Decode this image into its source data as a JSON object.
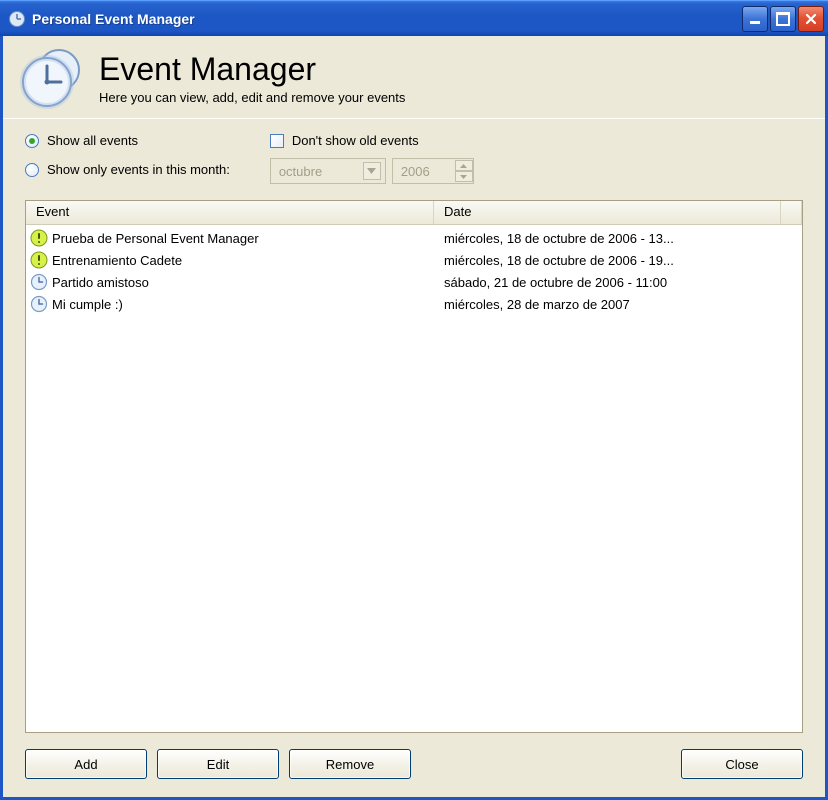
{
  "window": {
    "title": "Personal Event Manager"
  },
  "header": {
    "title": "Event Manager",
    "subtitle": "Here you can view, add, edit and remove your events"
  },
  "filters": {
    "show_all_label": "Show all events",
    "show_month_label": "Show only events in this month:",
    "dont_show_old_label": "Don't show old events",
    "selected_filter": "all",
    "dont_show_old_checked": false,
    "month_value": "octubre",
    "year_value": "2006",
    "month_year_enabled": false
  },
  "table": {
    "columns": {
      "event": "Event",
      "date": "Date"
    },
    "rows": [
      {
        "icon": "warning",
        "name": "Prueba de Personal Event Manager",
        "date": "miércoles, 18 de octubre de 2006 - 13..."
      },
      {
        "icon": "warning",
        "name": "Entrenamiento Cadete",
        "date": "miércoles, 18 de octubre de 2006 - 19..."
      },
      {
        "icon": "clock",
        "name": "Partido amistoso",
        "date": "sábado, 21 de octubre de 2006 - 11:00"
      },
      {
        "icon": "clock",
        "name": "Mi cumple :)",
        "date": "miércoles, 28 de marzo de 2007"
      }
    ]
  },
  "buttons": {
    "add": "Add",
    "edit": "Edit",
    "remove": "Remove",
    "close": "Close"
  }
}
